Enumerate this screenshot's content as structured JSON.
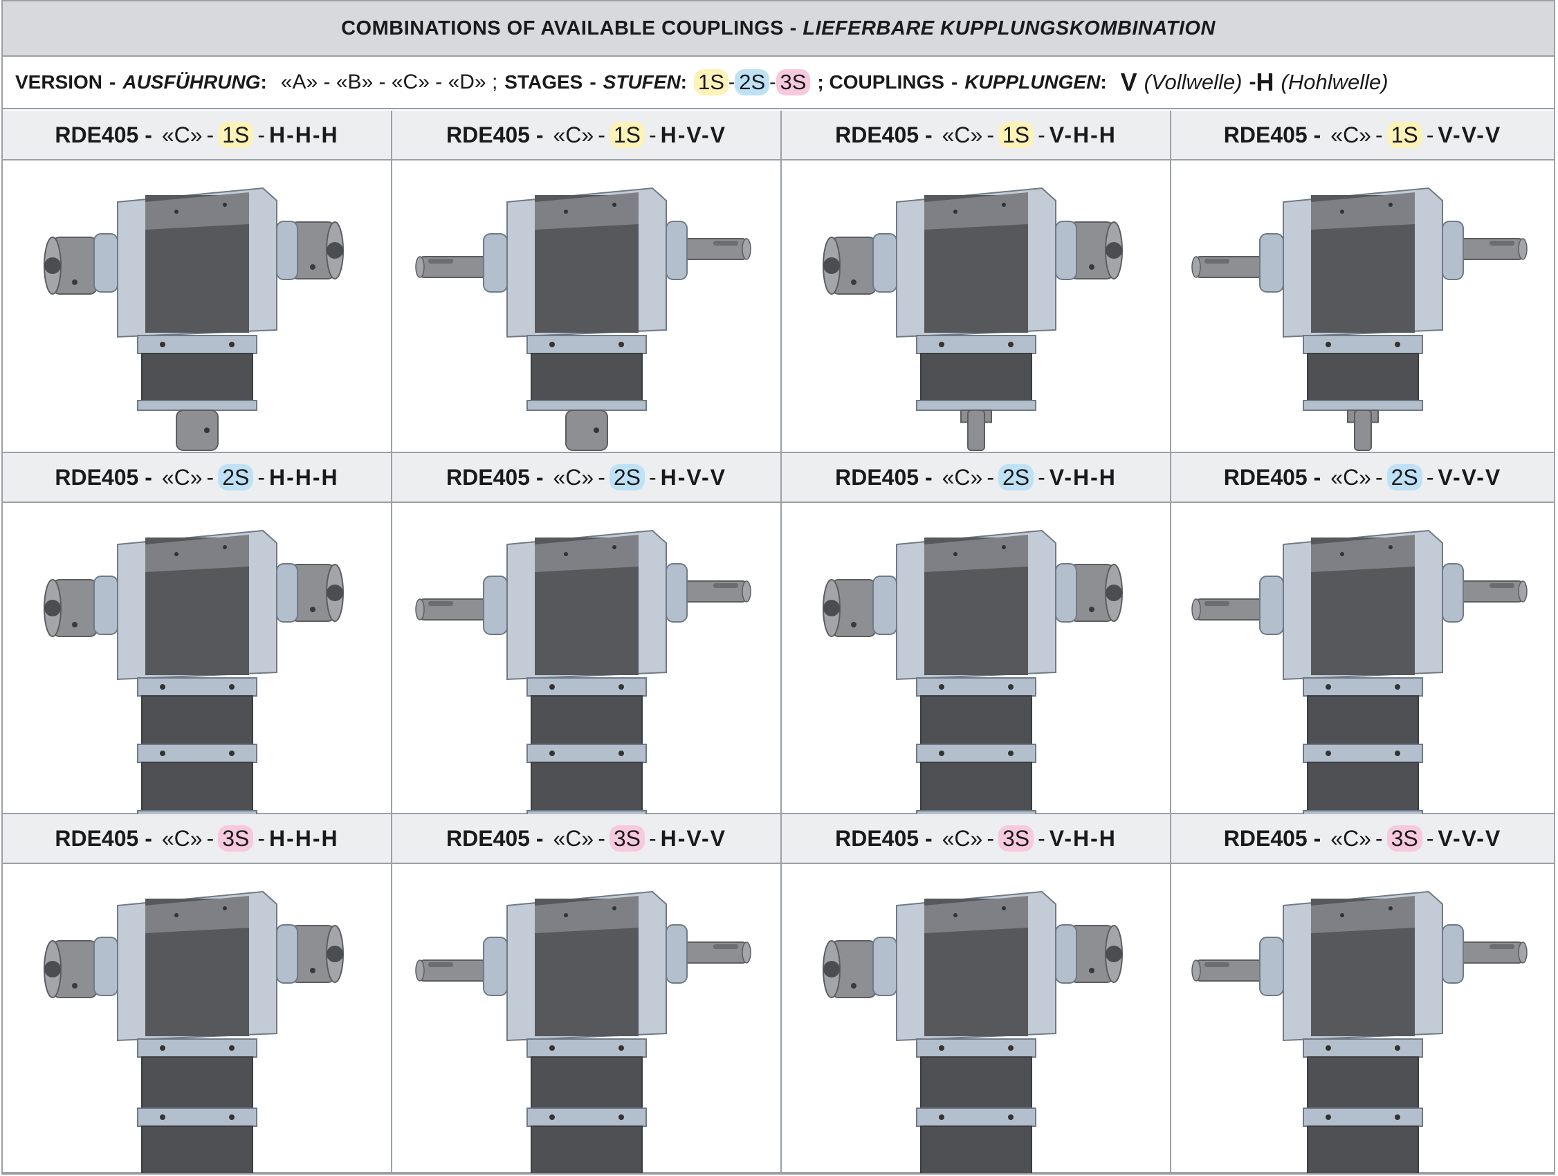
{
  "title": {
    "en": "COMBINATIONS OF AVAILABLE COUPLINGS",
    "sep": " - ",
    "de": "LIEFERBARE KUPPLUNGSKOMBINATION"
  },
  "legend": {
    "version_label": "VERSION",
    "version_label_de": "AUSFÜHRUNG",
    "versions": "«A» - «B» - «C» - «D» ;",
    "stages_label": "STAGES",
    "stages_label_de": "STUFEN",
    "stage_1": "1S",
    "stage_2": "2S",
    "stage_3": "3S",
    "couplings_label": "; COUPLINGS",
    "couplings_label_de": "KUPPLUNGEN",
    "v_code": "V",
    "v_name": "(Vollwelle)",
    "h_code": "H",
    "h_name": "(Hohlwelle)"
  },
  "colors": {
    "stage_1": "#fdf3b8",
    "stage_2": "#bfe1f5",
    "stage_3": "#f7c9dc"
  },
  "cells": [
    {
      "model": "RDE405 -",
      "version": "«C»",
      "stage": "1S",
      "coupling": "H-H-H"
    },
    {
      "model": "RDE405 -",
      "version": "«C»",
      "stage": "1S",
      "coupling": "H-V-V"
    },
    {
      "model": "RDE405 -",
      "version": "«C»",
      "stage": "1S",
      "coupling": "V-H-H"
    },
    {
      "model": "RDE405 -",
      "version": "«C»",
      "stage": "1S",
      "coupling": "V-V-V"
    },
    {
      "model": "RDE405 -",
      "version": "«C»",
      "stage": "2S",
      "coupling": "H-H-H"
    },
    {
      "model": "RDE405 -",
      "version": "«C»",
      "stage": "2S",
      "coupling": "H-V-V"
    },
    {
      "model": "RDE405 -",
      "version": "«C»",
      "stage": "2S",
      "coupling": "V-H-H"
    },
    {
      "model": "RDE405 -",
      "version": "«C»",
      "stage": "2S",
      "coupling": "V-V-V"
    },
    {
      "model": "RDE405 -",
      "version": "«C»",
      "stage": "3S",
      "coupling": "H-H-H"
    },
    {
      "model": "RDE405 -",
      "version": "«C»",
      "stage": "3S",
      "coupling": "H-V-V"
    },
    {
      "model": "RDE405 -",
      "version": "«C»",
      "stage": "3S",
      "coupling": "V-H-H"
    },
    {
      "model": "RDE405 -",
      "version": "«C»",
      "stage": "3S",
      "coupling": "V-V-V"
    }
  ]
}
